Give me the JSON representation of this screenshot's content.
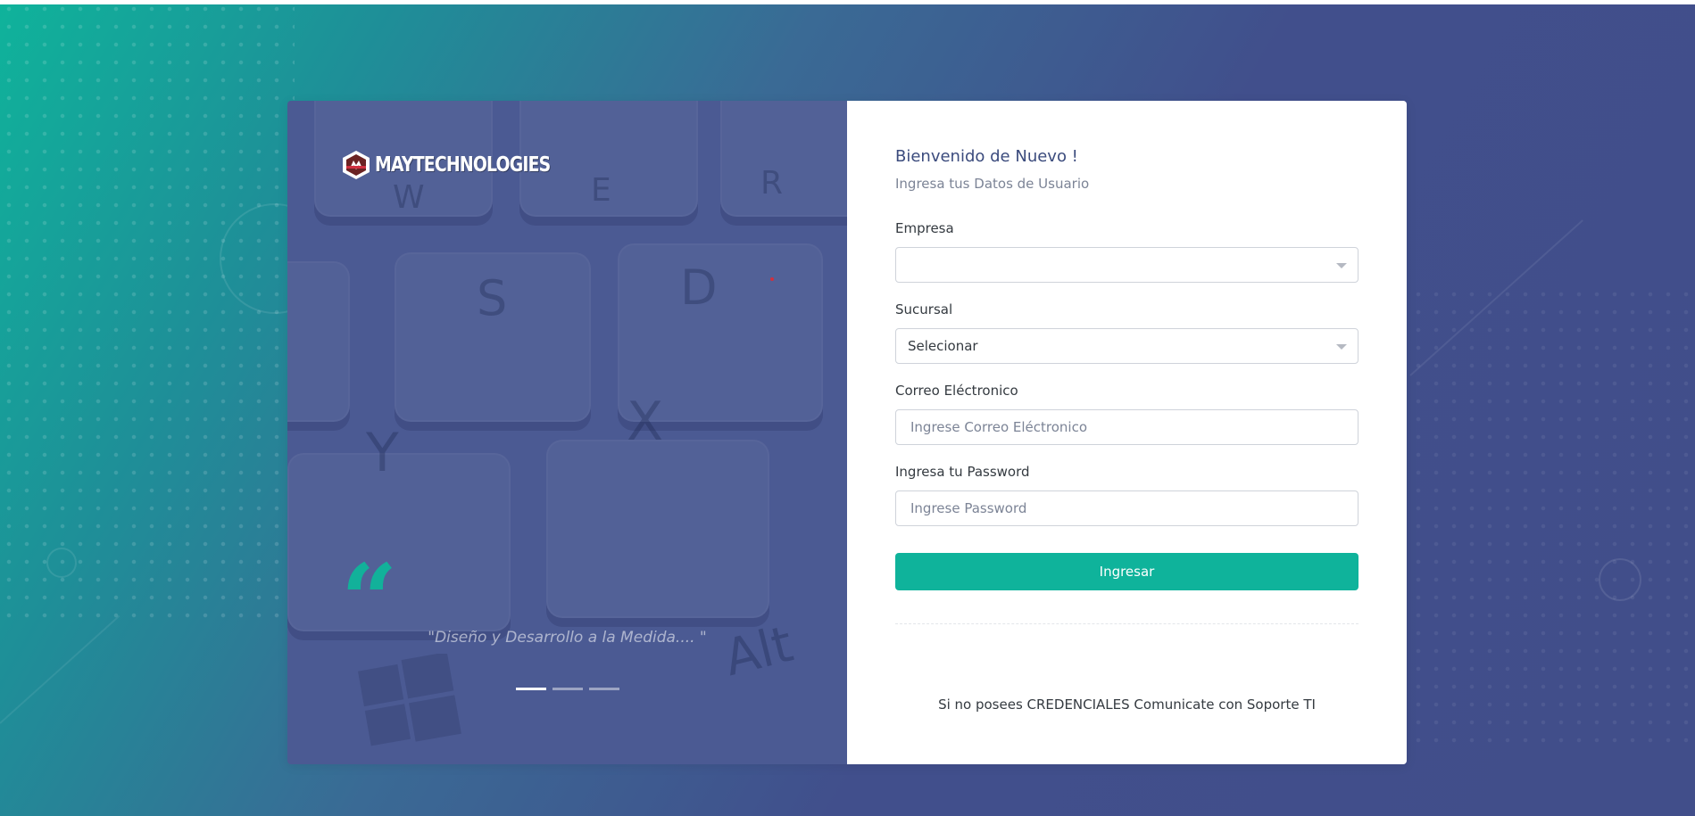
{
  "brand": {
    "logo_text": "MAYTECHNOLOGIES",
    "logo_icon": "shield-logo-icon",
    "accent_color": "#0fb39b",
    "panel_color": "#4b5a93"
  },
  "carousel": {
    "quote_icon": "quote-icon",
    "quote_mark": "“",
    "quote_text": "\"Diseño y Desarrollo a la Medida.... \"",
    "slides": 3,
    "active_slide": 1,
    "key_letters": [
      "W",
      "E",
      "R",
      "S",
      "D",
      "Y",
      "X",
      "Alt"
    ]
  },
  "login": {
    "title": "Bienvenido de Nuevo !",
    "subtitle": "Ingresa tus Datos de Usuario",
    "empresa": {
      "label": "Empresa",
      "value": ""
    },
    "sucursal": {
      "label": "Sucursal",
      "value": "Selecionar"
    },
    "email": {
      "label": "Correo Eléctronico",
      "placeholder": "Ingrese Correo Eléctronico",
      "value": ""
    },
    "password": {
      "label": "Ingresa tu Password",
      "placeholder": "Ingrese Password",
      "value": ""
    },
    "submit_label": "Ingresar",
    "footer_note": "Si no posees CREDENCIALES Comunicate con Soporte TI"
  }
}
